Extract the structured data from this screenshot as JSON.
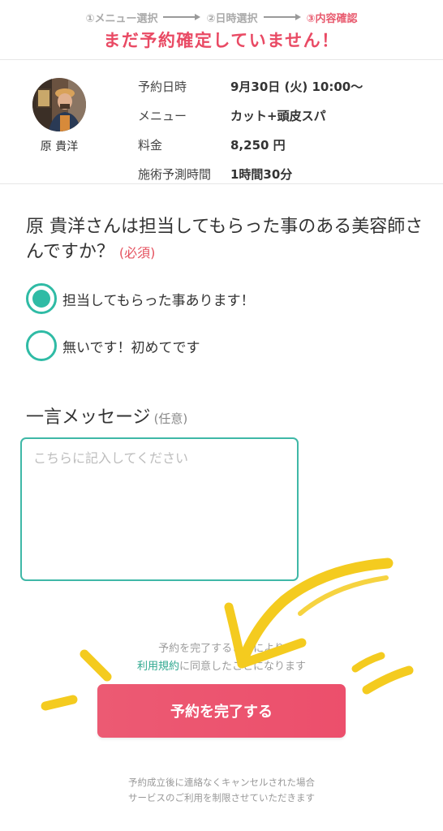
{
  "steps": [
    {
      "label": "①メニュー選択",
      "active": false
    },
    {
      "label": "②日時選択",
      "active": false
    },
    {
      "label": "③内容確認",
      "active": true
    }
  ],
  "warning": "まだ予約確定していません！",
  "stylist": {
    "name": "原 貴洋"
  },
  "summary": [
    {
      "label": "予約日時",
      "value": "9月30日 (火) 10:00〜"
    },
    {
      "label": "メニュー",
      "value": "カット+頭皮スパ"
    },
    {
      "label": "料金",
      "value": "8,250 円"
    },
    {
      "label": "施術予測時間",
      "value": "1時間30分"
    }
  ],
  "question": {
    "text": "原 貴洋さんは担当してもらった事のある美容師さんですか？",
    "required": "(必須)"
  },
  "options": [
    {
      "label": "担当してもらった事あります！",
      "selected": true
    },
    {
      "label": "無いです！初めてです",
      "selected": false
    }
  ],
  "message": {
    "title": "一言メッセージ",
    "optional": "(任意)",
    "placeholder": "こちらに記入してください",
    "value": ""
  },
  "agreement": {
    "line1": "予約を完了することにより",
    "link": "利用規約",
    "line2_suffix": "に同意したことになります"
  },
  "submit_label": "予約を完了する",
  "footer": {
    "line1": "予約成立後に連絡なくキャンセルされた場合",
    "line2": "サービスのご利用を制限させていただきます"
  },
  "colors": {
    "accent": "#2fbba5",
    "warning": "#e94a64",
    "button": "#ec5a73",
    "annotation": "#f4cb1f"
  }
}
